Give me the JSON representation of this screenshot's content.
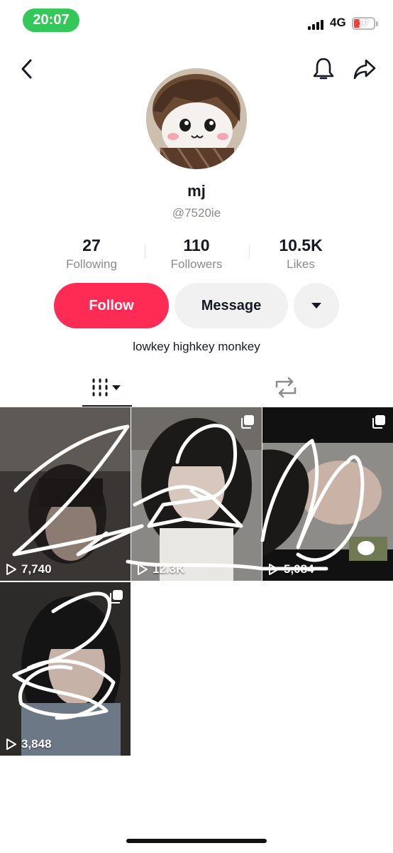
{
  "status_bar": {
    "time": "20:07",
    "network": "4G",
    "battery": "17"
  },
  "profile": {
    "display_name": "mj",
    "handle": "@7520ie",
    "bio": "lowkey highkey monkey",
    "stats": [
      {
        "value": "27",
        "label": "Following"
      },
      {
        "value": "110",
        "label": "Followers"
      },
      {
        "value": "10.5K",
        "label": "Likes"
      }
    ]
  },
  "actions": {
    "follow_label": "Follow",
    "message_label": "Message"
  },
  "colors": {
    "accent": "#fe2c55",
    "status_green": "#34c759",
    "secondary_btn": "#f1f1f2",
    "muted_text": "#8a8b91"
  },
  "icons": [
    "back-chevron-icon",
    "bell-icon",
    "share-arrow-icon",
    "chevron-down-icon",
    "grid-icon",
    "repost-icon",
    "play-icon",
    "multi-photo-icon"
  ],
  "videos": [
    {
      "views": "7,740"
    },
    {
      "views": "12.3K"
    },
    {
      "views": "5,084"
    },
    {
      "views": "3,848"
    }
  ]
}
